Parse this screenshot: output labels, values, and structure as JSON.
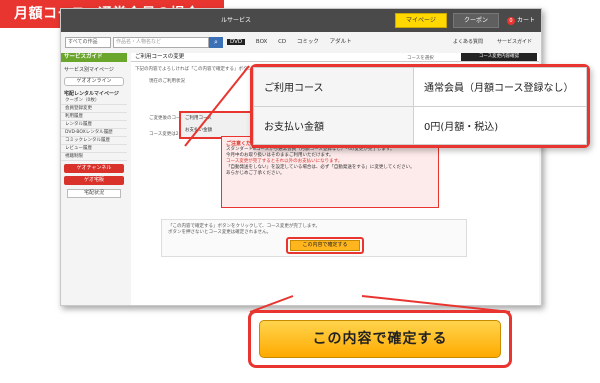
{
  "banner": {
    "title": "月額コース→通常会員の場合"
  },
  "topbar": {
    "service_label": "ルサービス",
    "mypage_label": "マイページ",
    "coupon_label": "クーポン",
    "cart_label": "カート",
    "cart_count": "0"
  },
  "search": {
    "select_value": "すべての作品",
    "placeholder": "作品名・人物名など",
    "categories": [
      "DVD",
      "BOX",
      "CD",
      "コミック",
      "アダルト"
    ],
    "faq_label": "よくある質問",
    "service_guide_label": "サービスガイド"
  },
  "sidebar": {
    "guide_label": "サービスガイド",
    "title": "サービス別マイページ",
    "gate_button": "ゲオオンライン",
    "rental_head": "宅配レンタルマイページ",
    "items": [
      "クーポン（0枚）",
      "会員登録変更",
      "利用履歴",
      "レンタル履歴",
      "DVD-BOXレンタル履歴",
      "コミックレンタル履歴",
      "レビュー履歴",
      "視聴制限"
    ],
    "geo_channel": "ゲオチャンネル",
    "geo_mall": "ゲオ宅販",
    "delivery_status": "宅配状況"
  },
  "main": {
    "heading": "ご利用コースの変更",
    "step_prev": "コースを選択",
    "step_current": "コース変更内容確認",
    "intro": "下記の内容でよろしければ「この内容で確定する」ボタンをクリックしてください。",
    "current_label": "現在のご利用状況",
    "after_label": "ご変更後のコース",
    "after_note": "コース変更は2月1日からの更新となります。",
    "small_rows": [
      {
        "key": "ご利用コース",
        "value": "通常会員（月額コース登録なし）"
      },
      {
        "key": "お支払い金額",
        "value": "0円（月額・税込）"
      }
    ]
  },
  "notice": {
    "heading": "ご注意ください",
    "line1": "スタンダード8コースから通常会員（月額コース登録なし）への変更が完了します。",
    "line2": "今月中のお取り扱いはそのままご利用いただけます。",
    "red1": "コース変更が完了するとそれ以外のお支払いになります。",
    "line3": "「自動発送をしない」を設定している場合は、必ず「自動発送をする」に変更してください。",
    "line4": "あらかじめご了承ください。"
  },
  "confirm": {
    "note1": "「この内容で確定する」ボタンをクリックして、コース変更が完了します。",
    "note2": "ボタンを押さないとコース変更は確定されません。",
    "button_label": "この内容で確定する"
  },
  "zoom_table": [
    {
      "key": "ご利用コース",
      "value": "通常会員（月額コース登録なし）"
    },
    {
      "key": "お支払い金額",
      "value": "0円(月額・税込)"
    }
  ],
  "zoom_button": {
    "label": "この内容で確定する"
  }
}
